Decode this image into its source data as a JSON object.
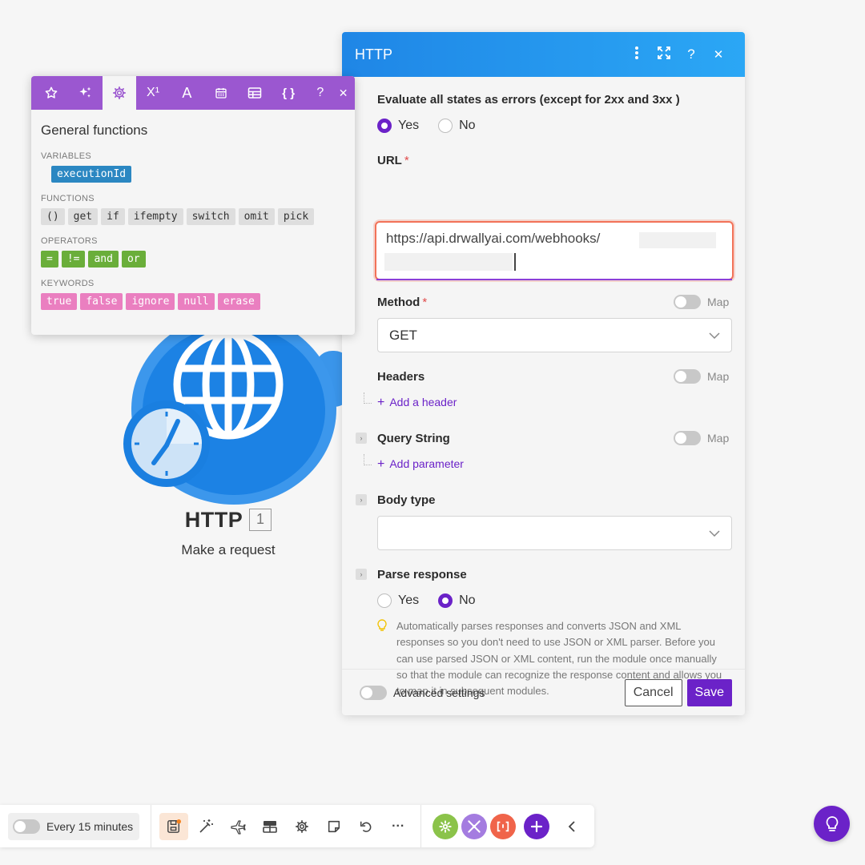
{
  "module": {
    "title": "HTTP",
    "index": "1",
    "subtitle": "Make a request"
  },
  "functions_panel": {
    "heading": "General functions",
    "tabs": [
      "star-icon",
      "sparkle-icon",
      "gear-icon",
      "superscript-icon",
      "text-icon",
      "calendar-icon",
      "table-icon",
      "braces-icon",
      "help-icon",
      "close-icon"
    ],
    "tab_labels": {
      "superscript": "X¹",
      "text": "A",
      "braces": "{ }",
      "help": "?",
      "close": "✕"
    },
    "sections": {
      "variables": {
        "title": "VARIABLES",
        "items": [
          "executionId"
        ]
      },
      "functions": {
        "title": "FUNCTIONS",
        "items": [
          "()",
          "get",
          "if",
          "ifempty",
          "switch",
          "omit",
          "pick"
        ]
      },
      "operators": {
        "title": "OPERATORS",
        "items": [
          "=",
          "!=",
          "and",
          "or"
        ]
      },
      "keywords": {
        "title": "KEYWORDS",
        "items": [
          "true",
          "false",
          "ignore",
          "null",
          "erase"
        ]
      }
    }
  },
  "http_panel": {
    "title": "HTTP",
    "header_buttons": {
      "help": "?",
      "close": "✕"
    },
    "evaluate_label": "Evaluate all states as errors (except for 2xx and 3xx )",
    "evaluate_options": {
      "yes": "Yes",
      "no": "No"
    },
    "evaluate_selected": "yes",
    "url_label": "URL",
    "required_mark": "*",
    "url_value": "https://api.drwallyai.com/webhooks/",
    "method_label": "Method",
    "map_label": "Map",
    "method_value": "GET",
    "headers_label": "Headers",
    "add_header": "Add a header",
    "query_label": "Query String",
    "add_parameter": "Add parameter",
    "body_type_label": "Body type",
    "body_type_value": "",
    "parse_label": "Parse response",
    "parse_options": {
      "yes": "Yes",
      "no": "No"
    },
    "parse_selected": "no",
    "parse_help": "Automatically parses responses and converts JSON and XML responses so you don't need to use JSON or XML parser. Before you can use parsed JSON or XML content, run the module once manually so that the module can recognize the response content and allows you to map it in subsequent modules.",
    "advanced_label": "Advanced settings",
    "cancel_label": "Cancel",
    "save_label": "Save"
  },
  "toolbar": {
    "schedule_label": "Every 15 minutes",
    "more_label": "···"
  },
  "colors": {
    "accent": "#6b22c8",
    "http_blue": "#1f86e6",
    "functions_purple": "#9b57d0",
    "url_focus": "#f27258"
  }
}
